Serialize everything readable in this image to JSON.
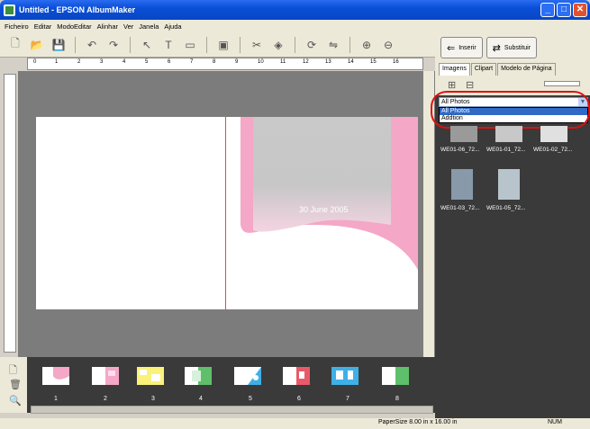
{
  "window": {
    "title": "Untitled - EPSON AlbumMaker"
  },
  "menu": [
    "Ficheiro",
    "Editar",
    "ModoEditar",
    "Alinhar",
    "Ver",
    "Janela",
    "Ajuda"
  ],
  "toolbar": {
    "icons": [
      "new-page-icon",
      "open-icon",
      "save-icon",
      "undo-icon",
      "redo-icon",
      "pointer-icon",
      "text-icon",
      "frame-icon",
      "image-icon",
      "crop-icon",
      "effect-icon",
      "rotate-icon",
      "zoom-in-icon",
      "zoom-out-icon"
    ]
  },
  "ruler": {
    "h": [
      "0",
      "1",
      "2",
      "3",
      "4",
      "5",
      "6",
      "7",
      "8",
      "9",
      "10",
      "11",
      "12",
      "13",
      "14",
      "15",
      "16"
    ]
  },
  "page": {
    "date_text": "30 June 2005"
  },
  "filmstrip": {
    "pages": [
      "1",
      "2",
      "3",
      "4",
      "5",
      "6",
      "7",
      "8"
    ]
  },
  "right_panel": {
    "insert_label": "Inserir",
    "replace_label": "Substituir",
    "tabs": [
      "Imagens",
      "Clipart",
      "Modelo de Página"
    ],
    "dropdown_value": "All Photos",
    "dropdown_options": [
      "All Photos",
      "Addtion"
    ],
    "thumbs": [
      "WE01-06_72...",
      "WE01-01_72...",
      "WE01-02_72...",
      "WE01-03_72...",
      "WE01-05_72..."
    ]
  },
  "status": {
    "paper_size": "PaperSize 8.00 in x 16.00 in",
    "num": "NUM"
  },
  "colors": {
    "titlebar": "#0a4fd8",
    "accent_pink": "#f4a7c6",
    "highlight": "#316ac5",
    "annotation_red": "#e01010"
  }
}
